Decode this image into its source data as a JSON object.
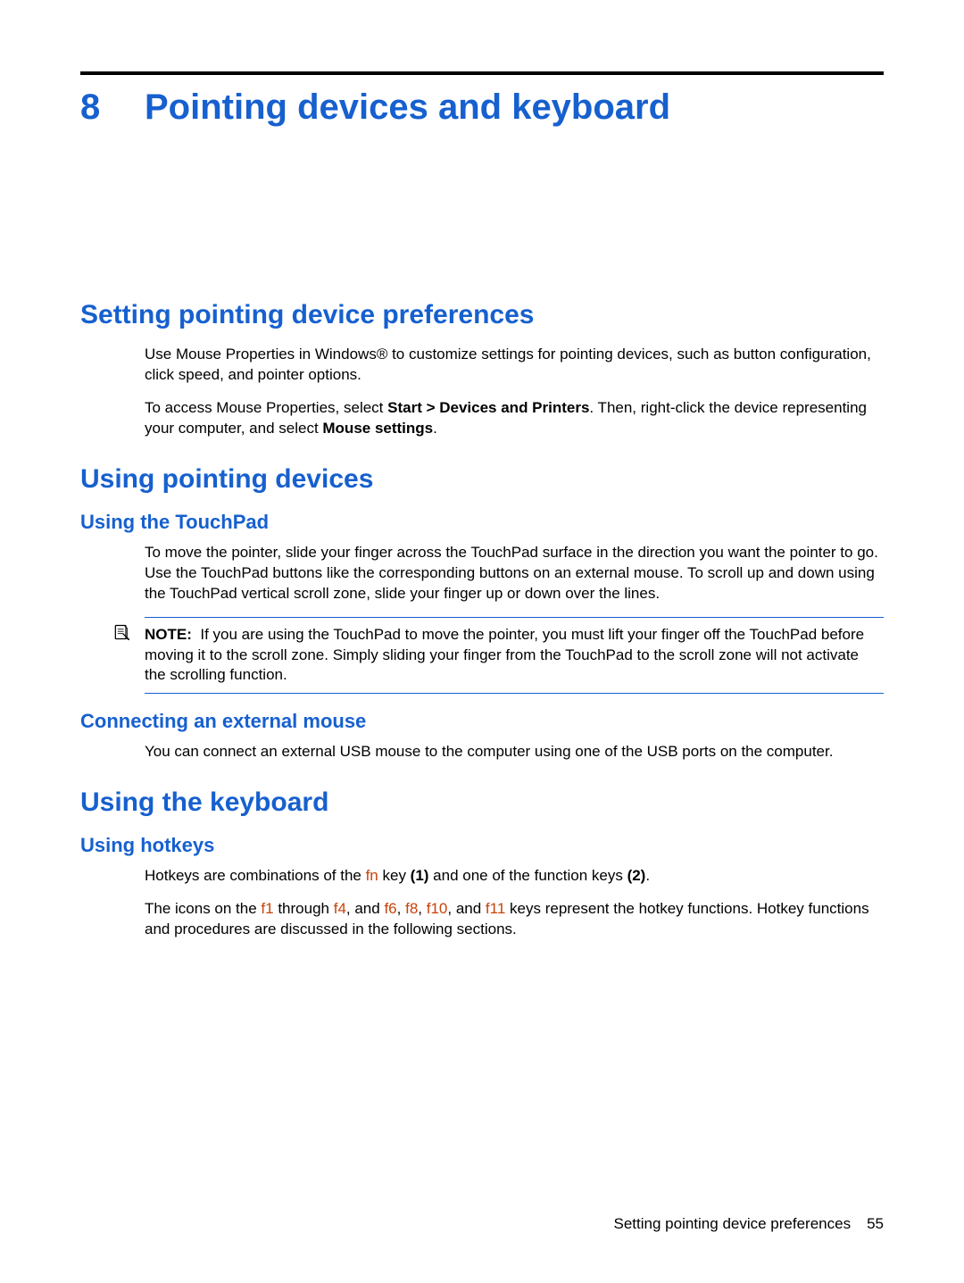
{
  "chapter": {
    "number": "8",
    "title": "Pointing devices and keyboard"
  },
  "sec1": {
    "heading": "Setting pointing device preferences",
    "p1a": "Use Mouse Properties in Windows",
    "p1b": " to customize settings for pointing devices, such as button configuration, click speed, and pointer options.",
    "reg": "®",
    "p2a": "To access Mouse Properties, select ",
    "p2b": "Start > Devices and Printers",
    "p2c": ". Then, right-click the device representing your computer, and select ",
    "p2d": "Mouse settings",
    "p2e": "."
  },
  "sec2": {
    "heading": "Using pointing devices",
    "sub1": {
      "heading": "Using the TouchPad",
      "p1": "To move the pointer, slide your finger across the TouchPad surface in the direction you want the pointer to go. Use the TouchPad buttons like the corresponding buttons on an external mouse. To scroll up and down using the TouchPad vertical scroll zone, slide your finger up or down over the lines.",
      "note_label": "NOTE:",
      "note_body": "If you are using the TouchPad to move the pointer, you must lift your finger off the TouchPad before moving it to the scroll zone. Simply sliding your finger from the TouchPad to the scroll zone will not activate the scrolling function."
    },
    "sub2": {
      "heading": "Connecting an external mouse",
      "p1": "You can connect an external USB mouse to the computer using one of the USB ports on the computer."
    }
  },
  "sec3": {
    "heading": "Using the keyboard",
    "sub1": {
      "heading": "Using hotkeys",
      "p1a": "Hotkeys are combinations of the ",
      "k_fn": "fn",
      "p1b": " key ",
      "p1c": "(1)",
      "p1d": " and one of the function keys ",
      "p1e": "(2)",
      "p1f": ".",
      "p2a": "The icons on the ",
      "k_f1": "f1",
      "p2b": " through ",
      "k_f4": "f4",
      "p2c": ", and ",
      "k_f6": "f6",
      "comma1": ", ",
      "k_f8": "f8",
      "comma2": ", ",
      "k_f10": "f10",
      "p2d": ", and ",
      "k_f11": "f11",
      "p2e": " keys represent the hotkey functions. Hotkey functions and procedures are discussed in the following sections."
    }
  },
  "footer": {
    "text": "Setting pointing device preferences",
    "page": "55"
  }
}
